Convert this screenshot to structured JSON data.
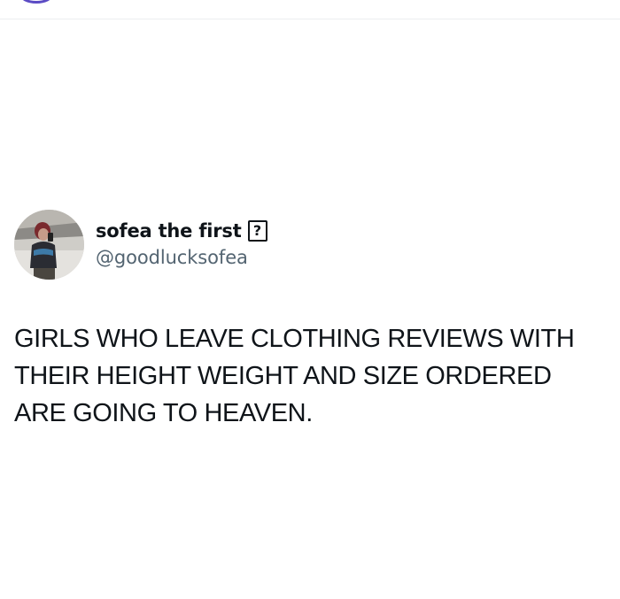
{
  "author": {
    "display_name": "sofea the first",
    "name_emoji_placeholder": "?",
    "handle": "@goodlucksofea"
  },
  "tweet": {
    "lines": [
      "GIRLS WHO LEAVE CLOTHING REVIEWS WITH",
      "THEIR HEIGHT WEIGHT AND SIZE ORDERED",
      "ARE GOING TO HEAVEN."
    ]
  },
  "colors": {
    "text_primary": "#0f1419",
    "text_secondary": "#536471",
    "divider": "#eceef0",
    "top_avatar_ring": "#5b4bc4"
  },
  "icons": {
    "name_glyph": "unknown-emoji-icon"
  }
}
